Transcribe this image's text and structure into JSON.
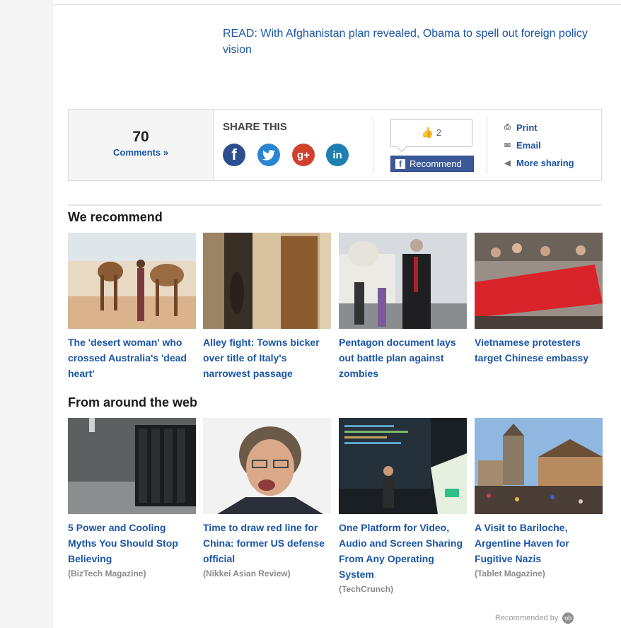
{
  "read_link": "READ: With Afghanistan plan revealed, Obama to spell out foreign policy vision",
  "comments": {
    "count": "70",
    "link_label": "Comments »"
  },
  "share": {
    "title": "SHARE THIS",
    "networks": [
      {
        "name": "facebook-icon",
        "glyph": "f"
      },
      {
        "name": "twitter-icon",
        "glyph": "t"
      },
      {
        "name": "google-plus-icon",
        "glyph": "g+"
      },
      {
        "name": "linkedin-icon",
        "glyph": "in"
      }
    ],
    "like_count": "2",
    "recommend_label": "Recommend",
    "links": [
      {
        "icon": "printer-icon",
        "label": "Print"
      },
      {
        "icon": "email-icon",
        "label": "Email"
      },
      {
        "icon": "share-icon",
        "label": "More sharing"
      }
    ]
  },
  "we_recommend": {
    "heading": "We recommend",
    "items": [
      {
        "title": "The 'desert woman' who crossed Australia's 'dead heart'"
      },
      {
        "title": "Alley fight: Towns bicker over title of Italy's narrowest passage"
      },
      {
        "title": "Pentagon document lays out battle plan against zombies"
      },
      {
        "title": "Vietnamese protesters target Chinese embassy"
      }
    ]
  },
  "around_web": {
    "heading": "From around the web",
    "items": [
      {
        "title": "5 Power and Cooling Myths You Should Stop Believing",
        "source": "(BizTech Magazine)"
      },
      {
        "title": "Time to draw red line for China: former US defense official",
        "source": "(Nikkei Asian Review)"
      },
      {
        "title": "One Platform for Video, Audio and Screen Sharing From Any Operating System",
        "source": "(TechCrunch)"
      },
      {
        "title": "A Visit to Bariloche, Argentine Haven for Fugitive Nazis",
        "source": "(Tablet Magazine)"
      }
    ]
  },
  "recommended_by": "Recommended by",
  "colors": {
    "link": "#1a55a6",
    "facebook": "#3b5998"
  }
}
